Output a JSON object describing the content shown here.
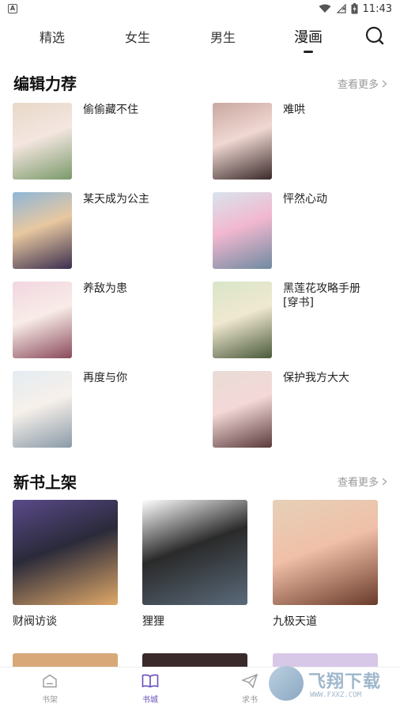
{
  "statusbar": {
    "time": "11:43",
    "badge": "A"
  },
  "tabs": [
    {
      "label": "精选"
    },
    {
      "label": "女生"
    },
    {
      "label": "男生"
    },
    {
      "label": "漫画"
    }
  ],
  "editor_section": {
    "title": "编辑力荐",
    "more": "查看更多",
    "items": [
      {
        "title": "偷偷藏不住",
        "colors": [
          "#e8d8c8",
          "#7a9a6a",
          "#f4e6e0"
        ]
      },
      {
        "title": "难哄",
        "colors": [
          "#c9a7a0",
          "#3a2a2a",
          "#f0d8d2"
        ]
      },
      {
        "title": "某天成为公主",
        "colors": [
          "#8fb6d8",
          "#3a2e4e",
          "#e8c8a0"
        ]
      },
      {
        "title": "怦然心动",
        "colors": [
          "#d8e4ec",
          "#6f8aa0",
          "#f2b8d0"
        ]
      },
      {
        "title": "养敌为患",
        "colors": [
          "#f2d6e0",
          "#8a4a5a",
          "#f8ece8"
        ]
      },
      {
        "title": "黑莲花攻略手册\n[穿书]",
        "colors": [
          "#d8e6c8",
          "#4a5a3a",
          "#f0e8d0"
        ]
      },
      {
        "title": "再度与你",
        "colors": [
          "#e4ecf2",
          "#8a9aa8",
          "#f6f0ea"
        ]
      },
      {
        "title": "保护我方大大",
        "colors": [
          "#e8dcd6",
          "#5a3a3a",
          "#f4d8d8"
        ]
      }
    ]
  },
  "new_section": {
    "title": "新书上架",
    "more": "查看更多",
    "items": [
      {
        "title": "财阀访谈",
        "colors": [
          "#5a4a8a",
          "#e0a868",
          "#2a2a3a"
        ]
      },
      {
        "title": "狸狸",
        "colors": [
          "#ffffff",
          "#5a6a7a",
          "#2a2a2a"
        ]
      },
      {
        "title": "九极天道",
        "colors": [
          "#e6d0b8",
          "#6a3a2a",
          "#f0c0a8"
        ]
      }
    ]
  },
  "peek_colors": [
    "#d8a878",
    "#3a2a2a",
    "#d8c8e8"
  ],
  "bottom_nav": [
    {
      "label": "书架",
      "icon": "bookshelf-icon"
    },
    {
      "label": "书城",
      "icon": "open-book-icon"
    },
    {
      "label": "求书",
      "icon": "paper-plane-icon"
    }
  ],
  "watermark": {
    "text": "飞翔下载",
    "url": "WWW.FXXZ.COM"
  },
  "accent_color": "#6b4fbb"
}
